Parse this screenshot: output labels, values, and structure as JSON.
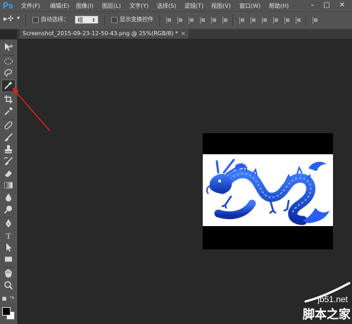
{
  "app": {
    "logo": "Ps"
  },
  "menu": [
    "文件(F)",
    "编辑(E)",
    "图像(I)",
    "图层(L)",
    "文字(Y)",
    "选择(S)",
    "滤镜(T)",
    "视图(V)",
    "窗口(W)",
    "帮助(H)"
  ],
  "window_controls": {
    "minimize": "–",
    "restore": "□",
    "close": "✕"
  },
  "options_bar": {
    "auto_select_label": "自动选择：",
    "auto_select_value": "组",
    "show_transform_label": "显示变换控件"
  },
  "document_tab": {
    "title": "Screenshot_2015-09-23-12-50-43.png @ 25%(RGB/8) *",
    "close": "×"
  },
  "tools": [
    "move-tool",
    "marquee-tool",
    "lasso-tool",
    "magic-wand-tool",
    "crop-tool",
    "eyedropper-tool",
    "healing-brush-tool",
    "brush-tool",
    "clone-stamp-tool",
    "history-brush-tool",
    "eraser-tool",
    "gradient-tool",
    "blur-tool",
    "dodge-tool",
    "pen-tool",
    "type-tool",
    "path-selection-tool",
    "rectangle-tool",
    "hand-tool",
    "zoom-tool"
  ],
  "type_tool_glyph": "T",
  "colors": {
    "foreground": "#000000",
    "background": "#ffffff",
    "arrow": "#e0201c",
    "dragon": "#1f4fd8",
    "ps_blue": "#31a8ff"
  },
  "watermark": {
    "domain": "jb51.net",
    "site": "脚本之家"
  }
}
